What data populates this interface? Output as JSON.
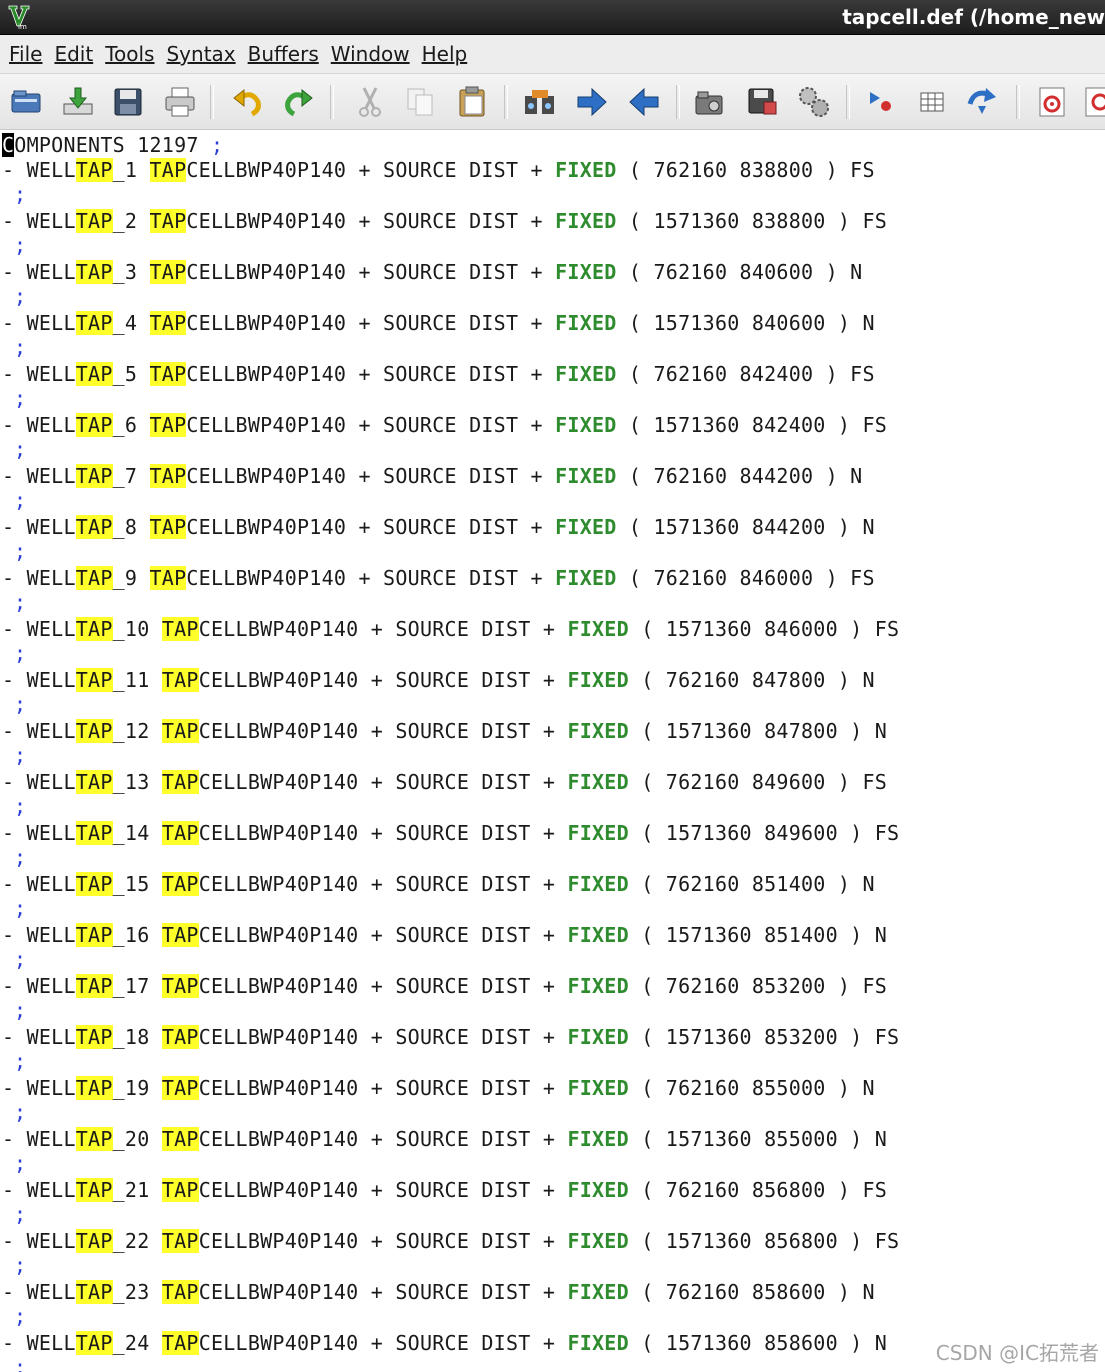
{
  "window": {
    "title": "tapcell.def (/home_new",
    "app_icon": "vim-icon"
  },
  "menu": [
    "File",
    "Edit",
    "Tools",
    "Syntax",
    "Buffers",
    "Window",
    "Help"
  ],
  "toolbar": {
    "icons": [
      "open-icon",
      "save-download-icon",
      "save-icon",
      "print-icon",
      "undo-icon",
      "redo-icon",
      "cut-icon",
      "copy-icon",
      "paste-icon",
      "find-replace-icon",
      "next-arrow-icon",
      "prev-arrow-icon",
      "load-session-icon",
      "save-session-icon",
      "run-script-icon",
      "make-icon",
      "table-icon",
      "jump-tag-icon",
      "help-icon",
      "find-help-icon"
    ]
  },
  "editor": {
    "cursor_char": "C",
    "first_line_rest": "OMPONENTS 12197 ",
    "first_line_semicolon": ";",
    "highlight_term": "TAP",
    "line_prefix": "- WELL",
    "cell_suffix": "CELLBWP40P140",
    "mid_text": " + SOURCE DIST + ",
    "fixed_keyword": "FIXED",
    "semicolon": ";",
    "rows": [
      {
        "num": "1",
        "x": "762160",
        "y": "838800",
        "orient": "FS"
      },
      {
        "num": "2",
        "x": "1571360",
        "y": "838800",
        "orient": "FS"
      },
      {
        "num": "3",
        "x": "762160",
        "y": "840600",
        "orient": "N"
      },
      {
        "num": "4",
        "x": "1571360",
        "y": "840600",
        "orient": "N"
      },
      {
        "num": "5",
        "x": "762160",
        "y": "842400",
        "orient": "FS"
      },
      {
        "num": "6",
        "x": "1571360",
        "y": "842400",
        "orient": "FS"
      },
      {
        "num": "7",
        "x": "762160",
        "y": "844200",
        "orient": "N"
      },
      {
        "num": "8",
        "x": "1571360",
        "y": "844200",
        "orient": "N"
      },
      {
        "num": "9",
        "x": "762160",
        "y": "846000",
        "orient": "FS"
      },
      {
        "num": "10",
        "x": "1571360",
        "y": "846000",
        "orient": "FS"
      },
      {
        "num": "11",
        "x": "762160",
        "y": "847800",
        "orient": "N"
      },
      {
        "num": "12",
        "x": "1571360",
        "y": "847800",
        "orient": "N"
      },
      {
        "num": "13",
        "x": "762160",
        "y": "849600",
        "orient": "FS"
      },
      {
        "num": "14",
        "x": "1571360",
        "y": "849600",
        "orient": "FS"
      },
      {
        "num": "15",
        "x": "762160",
        "y": "851400",
        "orient": "N"
      },
      {
        "num": "16",
        "x": "1571360",
        "y": "851400",
        "orient": "N"
      },
      {
        "num": "17",
        "x": "762160",
        "y": "853200",
        "orient": "FS"
      },
      {
        "num": "18",
        "x": "1571360",
        "y": "853200",
        "orient": "FS"
      },
      {
        "num": "19",
        "x": "762160",
        "y": "855000",
        "orient": "N"
      },
      {
        "num": "20",
        "x": "1571360",
        "y": "855000",
        "orient": "N"
      },
      {
        "num": "21",
        "x": "762160",
        "y": "856800",
        "orient": "FS"
      },
      {
        "num": "22",
        "x": "1571360",
        "y": "856800",
        "orient": "FS"
      },
      {
        "num": "23",
        "x": "762160",
        "y": "858600",
        "orient": "N"
      },
      {
        "num": "24",
        "x": "1571360",
        "y": "858600",
        "orient": "N"
      }
    ]
  },
  "watermark": "CSDN @IC拓荒者",
  "colors": {
    "fixed_keyword": "#2e8b2e",
    "semicolon": "#2a3ed6",
    "search_highlight": "#ffff2a",
    "titlebar": "#1c1c1c"
  }
}
